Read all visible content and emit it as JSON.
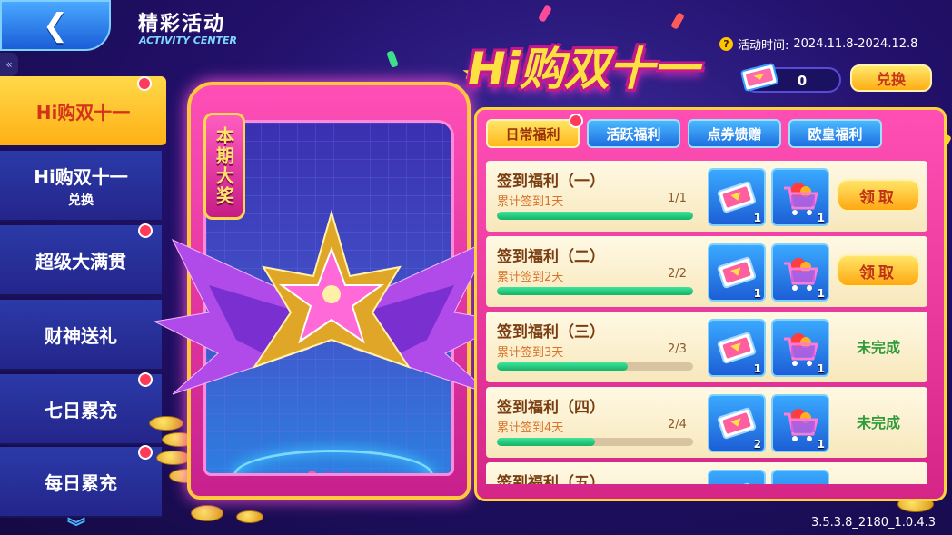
{
  "header": {
    "back_icon": "chevron-left-icon",
    "title": "精彩活动",
    "subtitle": "ACTIVITY CENTER"
  },
  "sidebar": {
    "items": [
      {
        "label": "Hi购双十一",
        "sub": "",
        "active": true,
        "red_dot": true
      },
      {
        "label": "Hi购双十一",
        "sub": "兑换",
        "active": false,
        "red_dot": false
      },
      {
        "label": "超级大满贯",
        "sub": "",
        "active": false,
        "red_dot": true
      },
      {
        "label": "财神送礼",
        "sub": "",
        "active": false,
        "red_dot": false
      },
      {
        "label": "七日累充",
        "sub": "",
        "active": false,
        "red_dot": true
      },
      {
        "label": "每日累充",
        "sub": "",
        "active": false,
        "red_dot": true
      }
    ],
    "more_icon": "chevron-down-icon"
  },
  "showcase": {
    "tag": "本期大奖",
    "pager_count": 3,
    "pager_active": 0
  },
  "event": {
    "title": "Hi购双十一",
    "time_label": "活动时间:",
    "time_range": "2024.11.8-2024.12.8",
    "coupon_count": "0",
    "exchange_label": "兑换"
  },
  "tabs": [
    {
      "label": "日常福利",
      "active": true,
      "red_dot": true
    },
    {
      "label": "活跃福利",
      "active": false,
      "red_dot": false
    },
    {
      "label": "点券馈赠",
      "active": false,
      "red_dot": false
    },
    {
      "label": "欧皇福利",
      "active": false,
      "red_dot": false
    }
  ],
  "tasks": [
    {
      "title": "签到福利（一）",
      "desc": "累计签到1天",
      "progress": "1/1",
      "fraction": 1.0,
      "coupon_qty": "1",
      "cart_qty": "1",
      "status": "claim",
      "action_label": "领取"
    },
    {
      "title": "签到福利（二）",
      "desc": "累计签到2天",
      "progress": "2/2",
      "fraction": 1.0,
      "coupon_qty": "1",
      "cart_qty": "1",
      "status": "claim",
      "action_label": "领取"
    },
    {
      "title": "签到福利（三）",
      "desc": "累计签到3天",
      "progress": "2/3",
      "fraction": 0.667,
      "coupon_qty": "1",
      "cart_qty": "1",
      "status": "incomplete",
      "action_label": "未完成"
    },
    {
      "title": "签到福利（四）",
      "desc": "累计签到4天",
      "progress": "2/4",
      "fraction": 0.5,
      "coupon_qty": "2",
      "cart_qty": "1",
      "status": "incomplete",
      "action_label": "未完成"
    },
    {
      "title": "签到福利（五）",
      "desc": "",
      "progress": "",
      "fraction": 0,
      "coupon_qty": "",
      "cart_qty": "",
      "status": "hidden",
      "action_label": ""
    }
  ],
  "footer": {
    "version": "3.5.3.8_2180_1.0.4.3"
  },
  "colors": {
    "accent": "#ffd43a",
    "panel": "#d52688",
    "progress": "#14b368",
    "incomplete": "#2f9b3a"
  }
}
